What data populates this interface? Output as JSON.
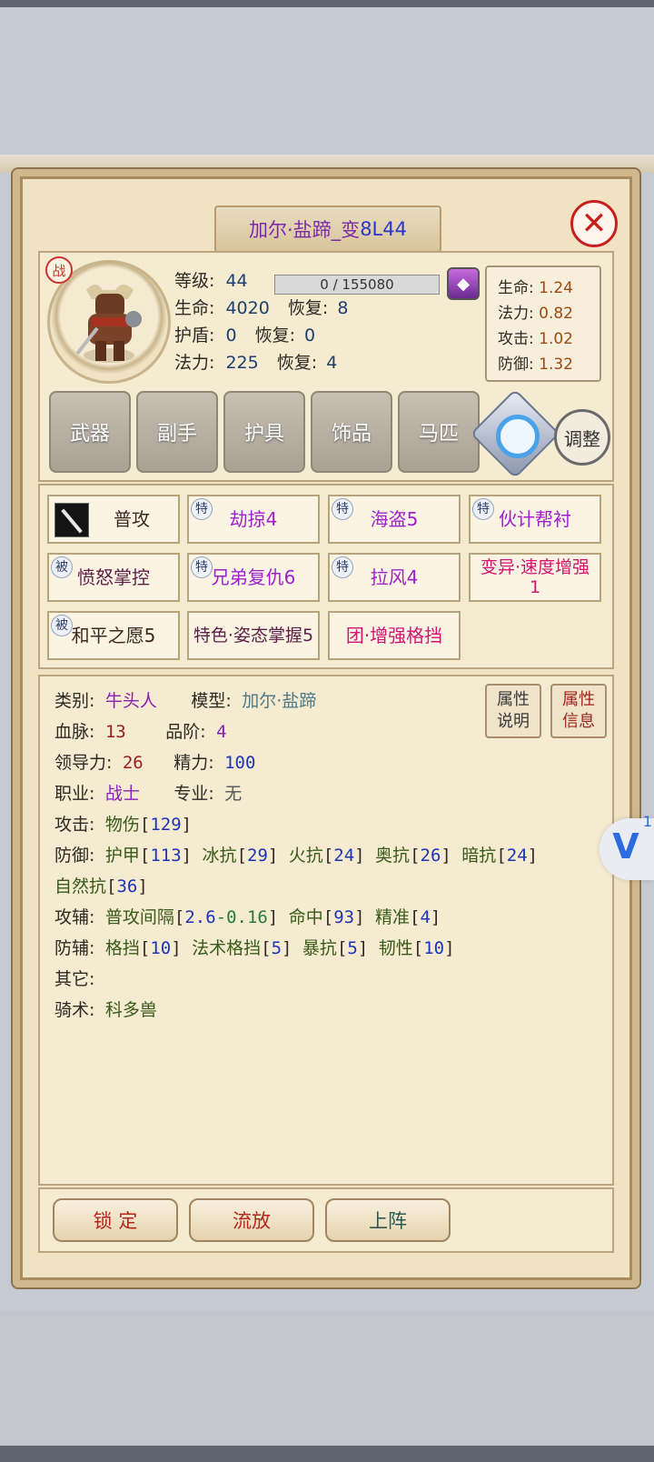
{
  "title": {
    "name_part1": "加尔·盐蹄_变",
    "name_part2": "8L44"
  },
  "close_symbol": "✕",
  "portrait": {
    "badge": "战"
  },
  "stats": {
    "level_label": "等级:",
    "level": "44",
    "exp": "0 / 155080",
    "hp_label": "生命:",
    "hp": "4020",
    "hp_regen_label": "恢复:",
    "hp_regen": "8",
    "shield_label": "护盾:",
    "shield": "0",
    "shield_regen_label": "恢复:",
    "shield_regen": "0",
    "mp_label": "法力:",
    "mp": "225",
    "mp_regen_label": "恢复:",
    "mp_regen": "4"
  },
  "growth": {
    "hp_label": "生命:",
    "hp": "1.24",
    "mp_label": "法力:",
    "mp": "0.82",
    "atk_label": "攻击:",
    "atk": "1.02",
    "def_label": "防御:",
    "def": "1.32"
  },
  "equipment": [
    "武器",
    "副手",
    "护具",
    "饰品",
    "马匹"
  ],
  "adjust_label": "调整",
  "skills": [
    {
      "tag": "",
      "name": "普攻"
    },
    {
      "tag": "特",
      "name": "劫掠4"
    },
    {
      "tag": "特",
      "name": "海盗5"
    },
    {
      "tag": "特",
      "name": "伙计帮衬"
    },
    {
      "tag": "被",
      "name": "愤怒掌控"
    },
    {
      "tag": "特",
      "name": "兄弟复仇6"
    },
    {
      "tag": "特",
      "name": "拉风4"
    },
    {
      "tag": "",
      "name": "变异·速度增强1"
    },
    {
      "tag": "被",
      "name": "和平之愿5"
    },
    {
      "tag": "",
      "name": "特色·姿态掌握5"
    },
    {
      "tag": "",
      "name": "团·增强格挡"
    }
  ],
  "attributes": {
    "category_label": "类别:",
    "category": "牛头人",
    "model_label": "模型:",
    "model": "加尔·盐蹄",
    "bloodline_label": "血脉:",
    "bloodline": "13",
    "grade_label": "品阶:",
    "grade": "4",
    "leadership_label": "领导力:",
    "leadership": "26",
    "energy_label": "精力:",
    "energy": "100",
    "job_label": "职业:",
    "job": "战士",
    "spec_label": "专业:",
    "spec": "无",
    "attack_label": "攻击:",
    "attack_type": "物伤",
    "attack_val": "129",
    "defense_label": "防御:",
    "armor_label": "护甲",
    "armor": "113",
    "ice_label": "冰抗",
    "ice": "29",
    "fire_label": "火抗",
    "fire": "24",
    "arcane_label": "奥抗",
    "arcane": "26",
    "shadow_label": "暗抗",
    "shadow": "24",
    "nature_label": "自然抗",
    "nature": "36",
    "atk_aux_label": "攻辅:",
    "interval_label": "普攻间隔",
    "interval": "2.6",
    "interval_mod": "-0.16",
    "hit_label": "命中",
    "hit": "93",
    "precision_label": "精准",
    "precision": "4",
    "def_aux_label": "防辅:",
    "block_label": "格挡",
    "block": "10",
    "spell_block_label": "法术格挡",
    "spell_block": "5",
    "crit_res_label": "暴抗",
    "crit_res": "5",
    "tenacity_label": "韧性",
    "tenacity": "10",
    "other_label": "其它:",
    "riding_label": "骑术:",
    "riding": "科多兽"
  },
  "side_buttons": {
    "attr_desc": "属性\n说明",
    "attr_info": "属性\n信息"
  },
  "bottom_buttons": {
    "lock": "锁 定",
    "release": "流放",
    "deploy": "上阵"
  },
  "floating": {
    "count": "1",
    "icon": "v-logo-icon"
  }
}
